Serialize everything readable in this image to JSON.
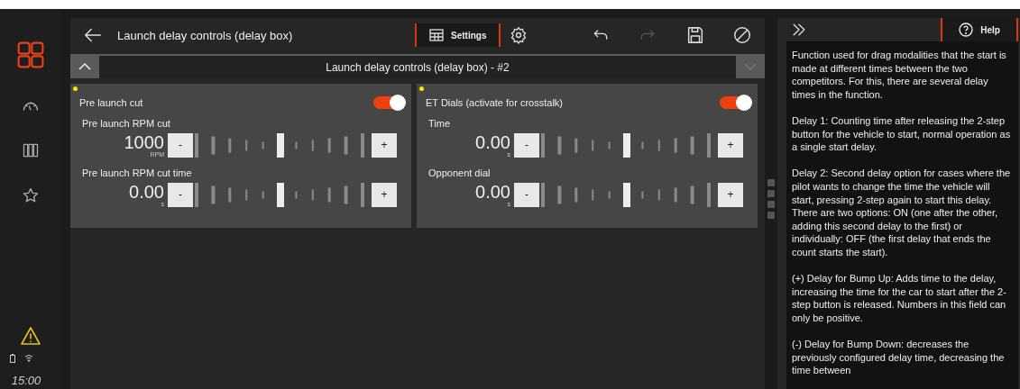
{
  "sidebar": {
    "items": [
      {
        "selected": true
      },
      {
        "selected": false
      },
      {
        "selected": false
      },
      {
        "selected": false
      }
    ],
    "time": "15:00"
  },
  "header": {
    "title": "Launch delay controls (delay box)",
    "tab": "Settings",
    "redo_disabled": true
  },
  "selector": {
    "value": "Launch delay controls (delay box) - #2"
  },
  "cards": [
    {
      "title": "Pre launch cut",
      "on": true,
      "controls": [
        {
          "label": "Pre launch RPM cut",
          "value": "1000",
          "unit": "RPM",
          "level": 0.5,
          "decrement": "-",
          "increment": "+"
        },
        {
          "label": "Pre launch RPM cut time",
          "value": "0.00",
          "unit": "s",
          "level": 0.5,
          "decrement": "-",
          "increment": "+"
        }
      ]
    },
    {
      "title": "ET Dials (activate for crosstalk)",
      "on": true,
      "controls": [
        {
          "label": "Time",
          "value": "0.00",
          "unit": "s",
          "level": 0.5,
          "decrement": "-",
          "increment": "+"
        },
        {
          "label": "Opponent dial",
          "value": "0.00",
          "unit": "s",
          "level": 0.5,
          "decrement": "-",
          "increment": "+"
        }
      ]
    }
  ],
  "help": {
    "button": "Help",
    "paragraphs": [
      "Function used for drag modalities that the start is made at different times between the two competitors. For this, there are several delay times in the function.",
      "Delay 1: Counting time after releasing the 2-step button for the vehicle to start, normal operation as a single start delay.",
      "Delay 2: Second delay option for cases where the pilot wants to change the time the vehicle will start, pressing 2-step again to start this delay. There are two options: ON (one after the other, adding this second delay to the first) or individually: OFF (the first delay that ends the count starts the start).",
      "(+) Delay for Bump Up: Adds time to the delay, increasing the time for the car to start after the 2-step button is released. Numbers in this field can only be positive.",
      "(-) Delay for Bump Down: decreases the previously configured delay time, decreasing the time between"
    ]
  }
}
